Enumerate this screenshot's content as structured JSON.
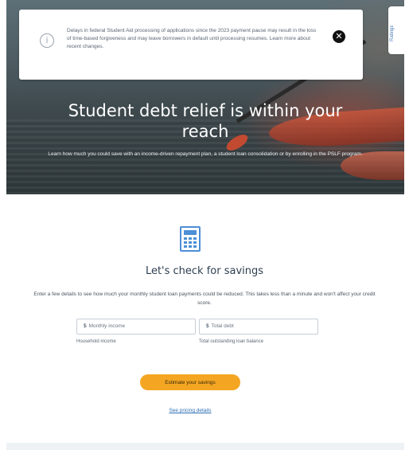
{
  "notice": {
    "text": "Delays in federal Student Aid processing of applications since the 2023 payment pause may result in the loss of time-based forgiveness and may leave borrowers in default until processing resumes. Learn more about recent changes.",
    "close_glyph": "✕",
    "info_glyph": "i"
  },
  "side_tab": {
    "label": "Ratings"
  },
  "hero": {
    "title_line1": "Student debt relief is within your",
    "title_line2": "reach",
    "subtitle": "Learn how much you could save with an income-driven repayment plan, a student loan consolidation or by enrolling in the PSLF program."
  },
  "calculator": {
    "icon": "calculator-icon",
    "title": "Let's check for savings",
    "description": "Enter a few details to see how much your monthly student loan payments could be reduced. This takes less than a minute and won't affect your credit score.",
    "fields": [
      {
        "prefix": "$",
        "placeholder": "Monthly income",
        "helper": "Household income"
      },
      {
        "prefix": "$",
        "placeholder": "Total debt",
        "helper": "Total outstanding loan balance"
      }
    ],
    "button_label": "Estimate your savings",
    "pricing_link": "See pricing details"
  },
  "colors": {
    "accent": "#f4a623",
    "link": "#2f6fb3",
    "icon_blue": "#4d8fd6"
  }
}
